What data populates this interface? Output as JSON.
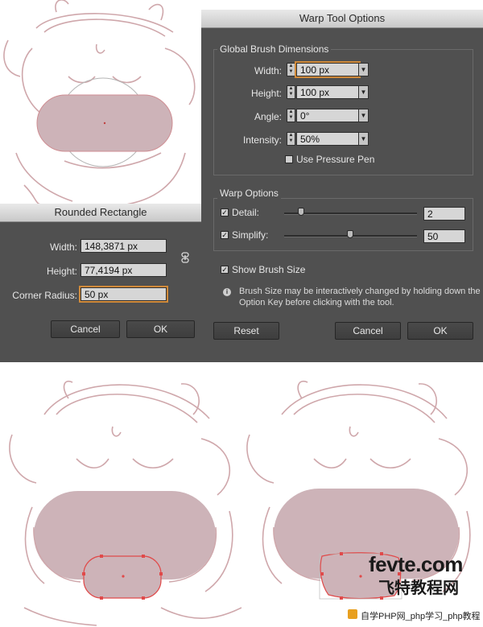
{
  "colors": {
    "dialog_bg": "#505050",
    "titlebar": "#d5d5d5",
    "sketch_line": "#cfa7ab",
    "shape_fill": "#cdb3b8",
    "selection": "#e04a4a",
    "focus_ring": "#d08a3a"
  },
  "rounded_rectangle_dialog": {
    "title": "Rounded Rectangle",
    "width_label": "Width:",
    "width_value": "148,3871 px",
    "height_label": "Height:",
    "height_value": "77,4194 px",
    "corner_radius_label": "Corner Radius:",
    "corner_radius_value": "50 px",
    "link_icon": "constrain-proportions-icon",
    "cancel_label": "Cancel",
    "ok_label": "OK"
  },
  "warp_dialog": {
    "title": "Warp Tool Options",
    "global_group_title": "Global Brush Dimensions",
    "width_label": "Width:",
    "width_value": "100 px",
    "height_label": "Height:",
    "height_value": "100 px",
    "angle_label": "Angle:",
    "angle_value": "0°",
    "intensity_label": "Intensity:",
    "intensity_value": "50%",
    "pressure_pen_label": "Use Pressure Pen",
    "pressure_pen_checked": false,
    "warp_group_title": "Warp Options",
    "detail_label": "Detail:",
    "detail_checked": true,
    "detail_value": "2",
    "simplify_label": "Simplify:",
    "simplify_checked": true,
    "simplify_value": "50",
    "show_brush_size_label": "Show Brush Size",
    "show_brush_size_checked": true,
    "note_line1": "Brush Size may be interactively changed by holding down the",
    "note_line2": "Option Key before clicking with the tool.",
    "reset_label": "Reset",
    "cancel_label": "Cancel",
    "ok_label": "OK"
  },
  "watermark": {
    "site": "fevte.com",
    "chinese": "飞特教程网",
    "bottom": "自学PHP网_php学习_php教程"
  }
}
